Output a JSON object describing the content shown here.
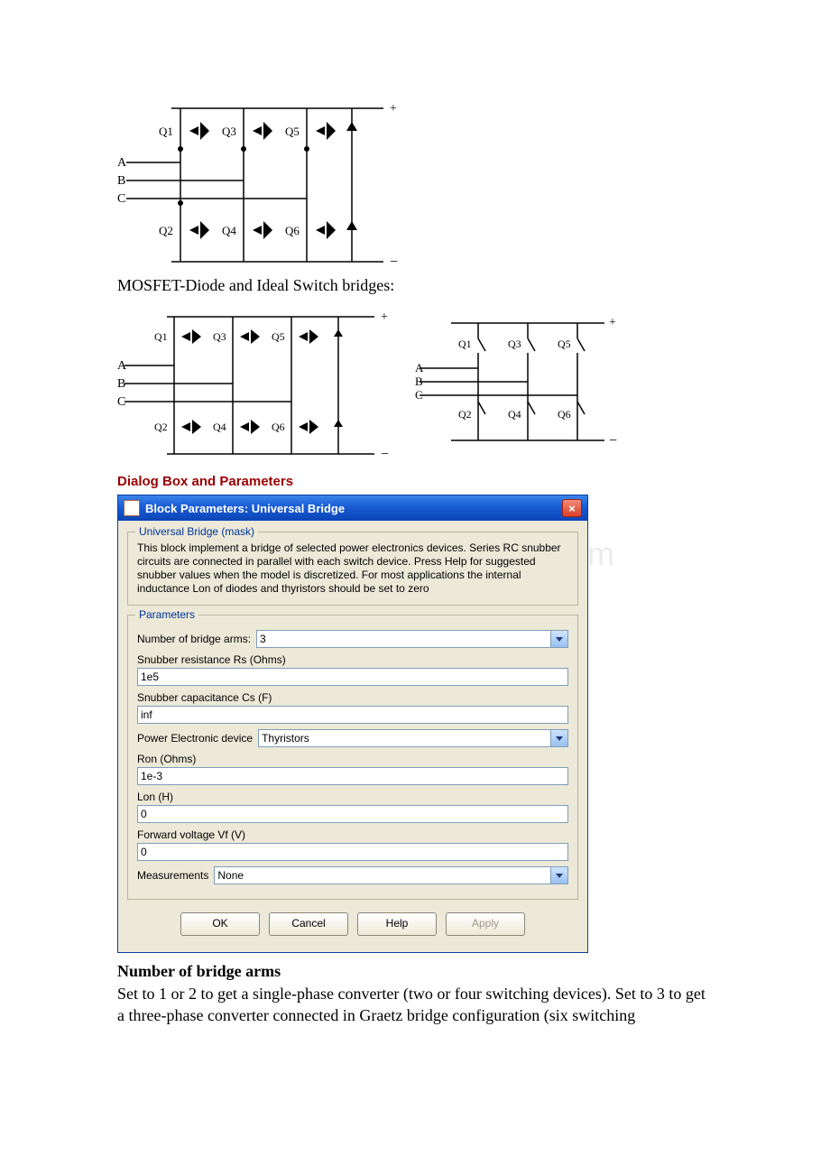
{
  "caption_mosfet": "MOSFET-Diode and Ideal Switch bridges:",
  "section_heading": "Dialog Box and Parameters",
  "sub_heading_arms": "Number of bridge arms",
  "arms_text": "Set to 1 or 2 to get a single-phase converter (two or four switching devices). Set to 3 to get a three-phase converter connected in Graetz bridge configuration (six switching",
  "diagram_labels": {
    "phases": [
      "A",
      "B",
      "C"
    ],
    "q_top": [
      "Q1",
      "Q3",
      "Q5"
    ],
    "q_bot": [
      "Q2",
      "Q4",
      "Q6"
    ],
    "plus": "+",
    "minus": "−"
  },
  "dialog": {
    "title": "Block Parameters: Universal Bridge",
    "mask_legend": "Universal Bridge (mask)",
    "description": "This block implement a bridge of selected power electronics devices.  Series RC snubber circuits are connected in parallel with each switch device.  Press Help for suggested snubber values when the model is discretized. For most applications the internal inductance Lon of diodes and thyristors should be set to zero",
    "params_legend": "Parameters",
    "fields": {
      "bridge_arms_label": "Number of bridge arms:",
      "bridge_arms_value": "3",
      "snubber_r_label": "Snubber resistance Rs (Ohms)",
      "snubber_r_value": "1e5",
      "snubber_c_label": "Snubber capacitance Cs (F)",
      "snubber_c_value": "inf",
      "device_label": "Power Electronic device",
      "device_value": "Thyristors",
      "ron_label": "Ron (Ohms)",
      "ron_value": "1e-3",
      "lon_label": "Lon (H)",
      "lon_value": "0",
      "vf_label": "Forward voltage Vf (V)",
      "vf_value": "0",
      "meas_label": "Measurements",
      "meas_value": "None"
    },
    "buttons": {
      "ok": "OK",
      "cancel": "Cancel",
      "help": "Help",
      "apply": "Apply"
    }
  }
}
